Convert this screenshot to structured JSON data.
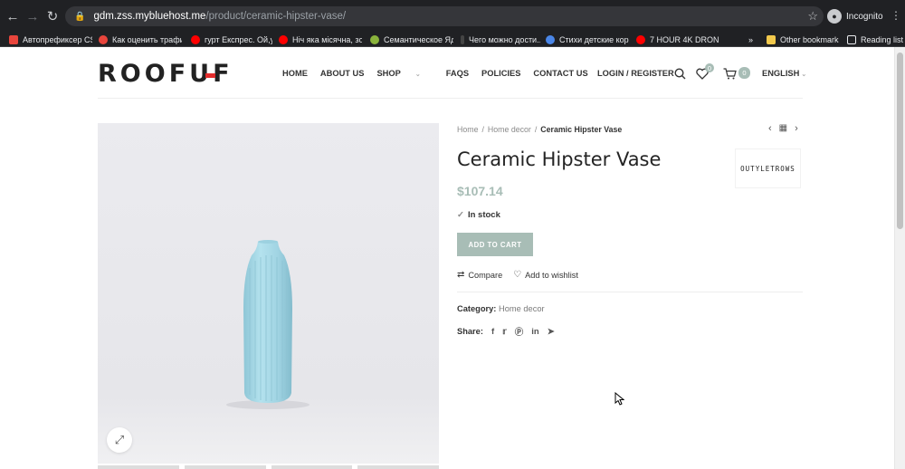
{
  "browser": {
    "url_host": "gdm.zss.mybluehost.me",
    "url_path": "/product/ceramic-hipster-vase/",
    "profile_label": "Incognito",
    "bookmarks": [
      {
        "label": "Автопрефиксер CS...",
        "color": "#e8453c"
      },
      {
        "label": "Как оценить трафи...",
        "color": "#e8453c"
      },
      {
        "label": "гурт Експрес. Ой,у...",
        "color": "#ff0000"
      },
      {
        "label": "Ніч яка місячна, зо...",
        "color": "#ff0000"
      },
      {
        "label": "Семантическое Яд...",
        "color": "#8ab33c"
      },
      {
        "label": "Чего можно дости...",
        "color": "#444444"
      },
      {
        "label": "Стихи детские кор...",
        "color": "#4a86e8"
      },
      {
        "label": "7 HOUR 4K DRONE...",
        "color": "#ff0000"
      }
    ],
    "overflow_label": "»",
    "other_bookmarks_label": "Other bookmarks",
    "reading_list_label": "Reading list"
  },
  "site": {
    "logo": "ROOFUF",
    "nav": [
      "HOME",
      "ABOUT US",
      "SHOP",
      "FAQS",
      "POLICIES",
      "CONTACT US"
    ],
    "login_label": "LOGIN / REGISTER",
    "wishlist_count": "0",
    "cart_count": "0",
    "language": "ENGLISH"
  },
  "product": {
    "breadcrumb": [
      "Home",
      "Home decor",
      "Ceramic Hipster Vase"
    ],
    "title": "Ceramic Hipster Vase",
    "brand_logo_text": "OUTYLETROWS",
    "price": "$107.14",
    "stock": "In stock",
    "add_to_cart": "ADD TO CART",
    "compare": "Compare",
    "wishlist": "Add to wishlist",
    "category_label": "Category:",
    "category_value": "Home decor",
    "share_label": "Share:",
    "share_icons": [
      "facebook-icon",
      "twitter-icon",
      "pinterest-icon",
      "linkedin-icon",
      "telegram-icon"
    ]
  },
  "colors": {
    "accent": "#a8bdb6",
    "logo_mark": "#e32d2d",
    "vase": "#a8dbe8"
  }
}
